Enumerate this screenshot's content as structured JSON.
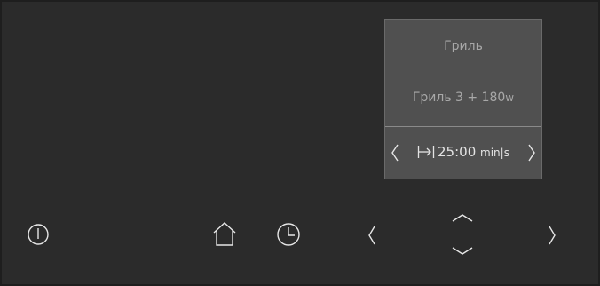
{
  "panel": {
    "title": "Гриль",
    "mode_text": "Гриль 3 + 180",
    "mode_unit": "w",
    "time_value": "25:00",
    "time_unit": "min|s",
    "duration_icon": "duration-arrow-icon",
    "prev_icon": "chevron-left-icon",
    "next_icon": "chevron-right-icon"
  },
  "controls": {
    "power_icon": "power-icon",
    "home_icon": "home-icon",
    "timer_icon": "clock-icon",
    "left_icon": "chevron-left-icon",
    "up_icon": "chevron-up-icon",
    "down_icon": "chevron-down-icon",
    "right_icon": "chevron-right-icon"
  },
  "colors": {
    "background": "#2b2b2b",
    "panel": "#505050",
    "icon": "#e6e6e6"
  }
}
